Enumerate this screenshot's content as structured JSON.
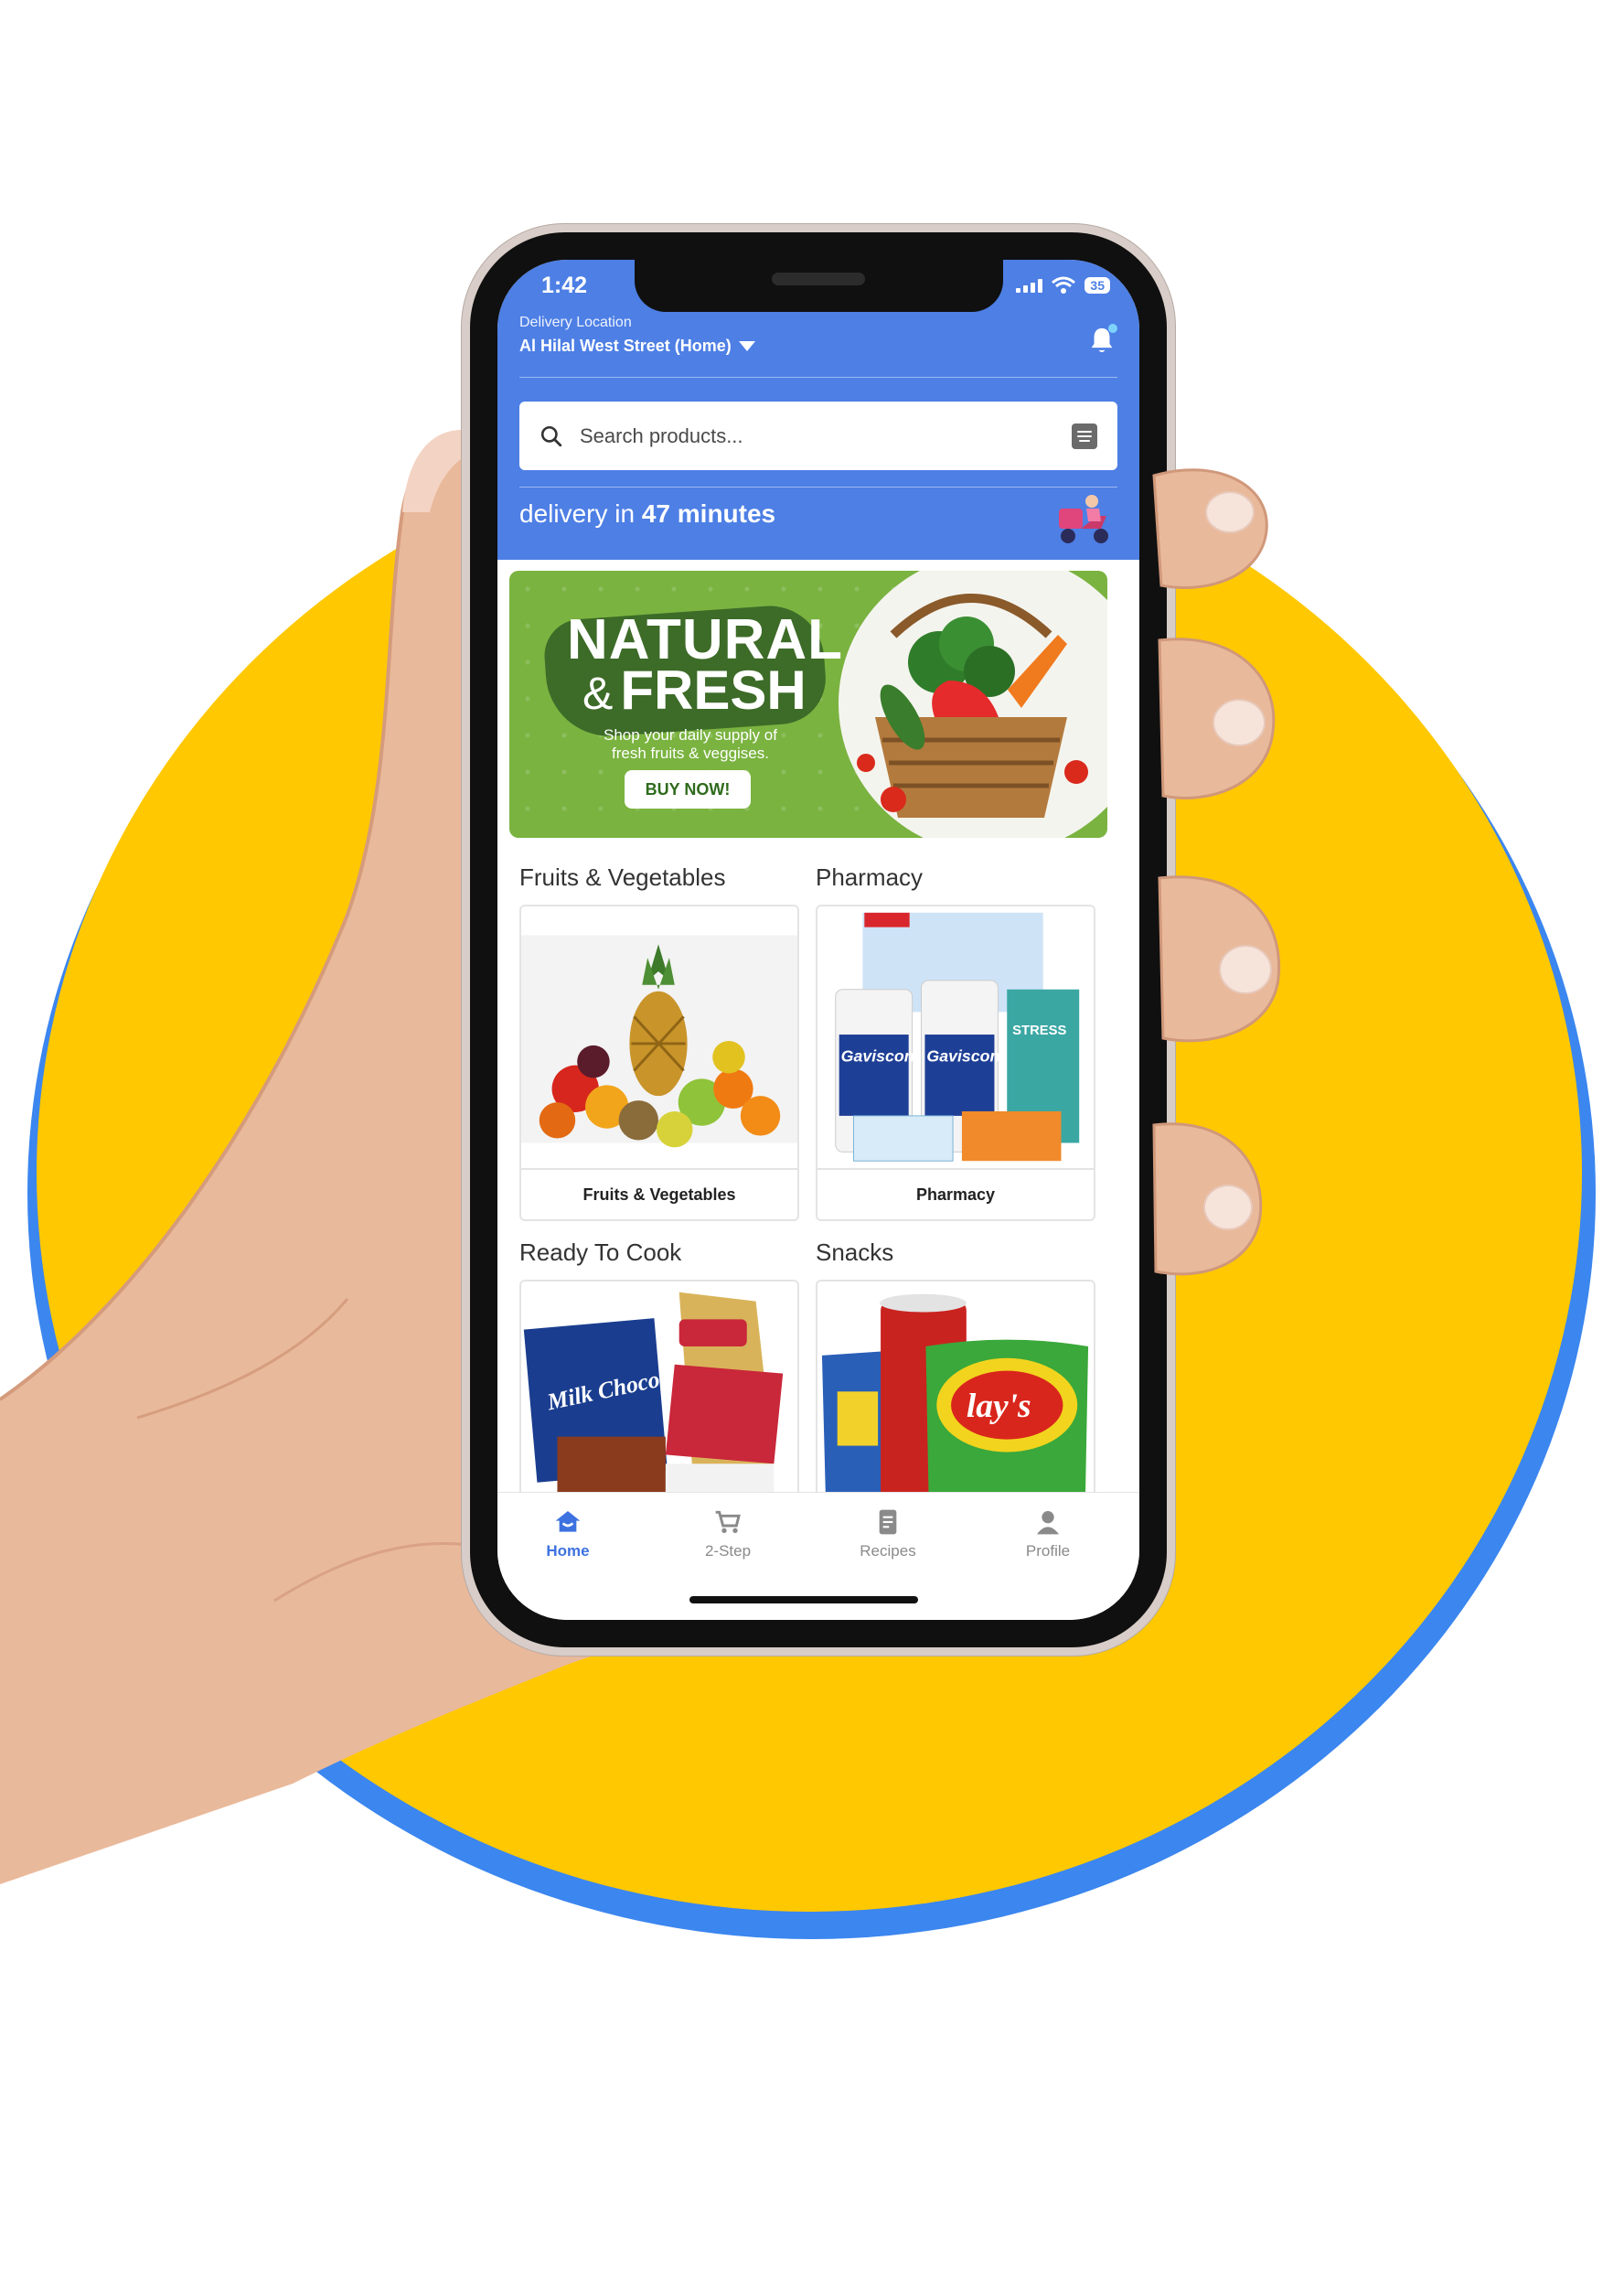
{
  "status_bar": {
    "time": "1:42",
    "battery": "35"
  },
  "header": {
    "location_caption": "Delivery Location",
    "location_value": "Al Hilal West Street (Home)"
  },
  "search": {
    "placeholder": "Search products..."
  },
  "delivery": {
    "prefix": "delivery in",
    "time": "47 minutes"
  },
  "banner": {
    "title_line1": "NATURAL",
    "title_amp": "&",
    "title_line2": "FRESH",
    "subtitle": "Shop your daily supply of fresh fruits & veggises.",
    "button": "BUY NOW!"
  },
  "categories": [
    {
      "title": "Fruits & Vegetables",
      "label": "Fruits & Vegetables"
    },
    {
      "title": "Pharmacy",
      "label": "Pharmacy"
    },
    {
      "title": "Ready To Cook",
      "label": ""
    },
    {
      "title": "Snacks",
      "label": ""
    }
  ],
  "product_texts": {
    "gaviscon": "Gaviscon",
    "stress": "STRESS",
    "milk_chocolate": "Milk Chocolate",
    "lays": "lay's"
  },
  "tabs": [
    {
      "label": "Home",
      "icon": "home-icon",
      "active": true
    },
    {
      "label": "2-Step",
      "icon": "cart-icon",
      "active": false
    },
    {
      "label": "Recipes",
      "icon": "document-icon",
      "active": false
    },
    {
      "label": "Profile",
      "icon": "person-icon",
      "active": false
    }
  ],
  "colors": {
    "header_blue": "#4d7fe5",
    "circle_yellow": "#ffc800",
    "circle_blue": "#3b86ef",
    "banner_green": "#7ab340",
    "tab_active": "#3d72e0"
  }
}
